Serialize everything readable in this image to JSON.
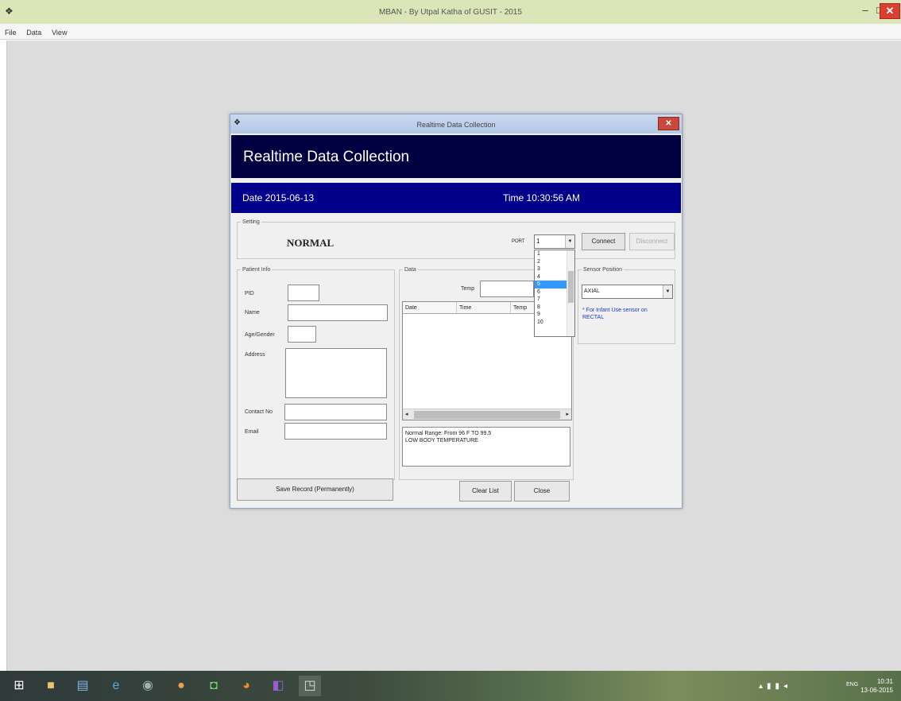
{
  "main_window": {
    "title": "MBAN - By Utpal Katha of GUSIT - 2015",
    "menu": [
      "File",
      "Data",
      "View"
    ]
  },
  "dialog": {
    "title": "Realtime Data Collection",
    "header": "Realtime Data Collection",
    "date": "Date 2015-06-13",
    "time": "Time 10:30:56 AM",
    "setting_legend": "Setting",
    "status": "NORMAL",
    "port_label": "PORT",
    "port_value": "1",
    "port_options": [
      "1",
      "2",
      "3",
      "4",
      "5",
      "6",
      "7",
      "8",
      "9",
      "10"
    ],
    "connect_label": "Connect",
    "disconnect_label": "Disconnect",
    "patient_legend": "Patient Info",
    "patient_fields": {
      "pid": "PID",
      "name": "Name",
      "age_gender": "Age/Gender",
      "address": "Address",
      "contact": "Contact No",
      "email": "Email"
    },
    "data_legend": "Data",
    "temp_label": "Temp",
    "grid_columns": [
      "Date",
      "Time",
      "Temp"
    ],
    "note_lines": [
      "Normal Range: From 96 F TO 99.5",
      "LOW BODY TEMPERATURE"
    ],
    "sensor_legend": "Sensor Position",
    "sensor_value": "AXIAL",
    "sensor_note": "* For Infant Use sensor on RECTAL",
    "save_label": "Save Record (Permanently)",
    "clear_label": "Clear List",
    "close_label": "Close"
  },
  "taskbar": {
    "clock_time": "10:31",
    "clock_date": "13-06-2015",
    "lang": "ENG"
  },
  "colors": {
    "header_bg": "#000040",
    "date_bar_bg": "#00008b",
    "selection": "#3399ff",
    "close_button": "#d9402f"
  }
}
